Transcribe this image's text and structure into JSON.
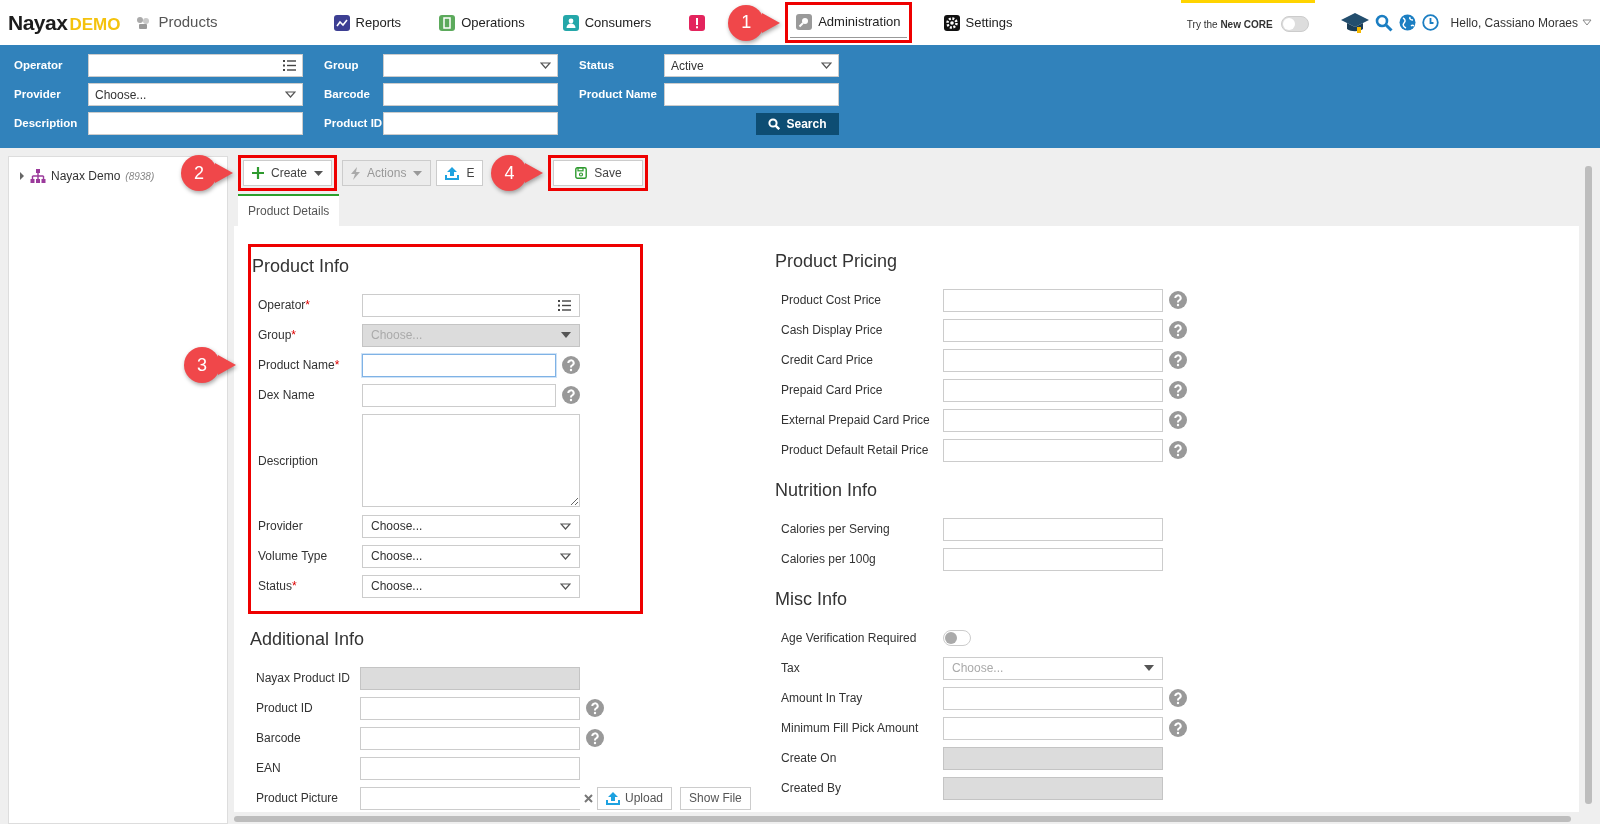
{
  "header": {
    "logo": "Nayax",
    "logo_tag": "DEMO",
    "page_title": "Products",
    "nav": [
      {
        "kind": "reports",
        "label": "Reports",
        "selected": false,
        "highlighted": false
      },
      {
        "kind": "operations",
        "label": "Operations",
        "selected": false,
        "highlighted": false
      },
      {
        "kind": "consumers",
        "label": "Consumers",
        "selected": false,
        "highlighted": false
      },
      {
        "kind": "alerts",
        "selected": false,
        "highlighted": false
      },
      {
        "kind": "administration",
        "label": "Administration",
        "selected": true,
        "highlighted": true,
        "callout": "1"
      },
      {
        "kind": "settings",
        "label": "Settings",
        "selected": false,
        "highlighted": false
      }
    ],
    "promo": {
      "text": "Try the **New CORE**",
      "on": false
    },
    "greeting": "Hello, Cassiano Moraes"
  },
  "filters": {
    "fields": [
      {
        "label": "Operator",
        "kind": "list"
      },
      {
        "label": "Group",
        "kind": "select"
      },
      {
        "label": "Status",
        "kind": "select",
        "value": "Active"
      },
      {
        "label": "Provider",
        "kind": "select",
        "value": "Choose..."
      },
      {
        "label": "Barcode",
        "kind": "text"
      },
      {
        "label": "Product Name",
        "kind": "text"
      },
      {
        "label": "Description",
        "kind": "text"
      },
      {
        "label": "Product ID",
        "kind": "text"
      }
    ],
    "search_label": "Search"
  },
  "tree": [
    {
      "label": "Nayax Demo",
      "count": "(8938)",
      "expanded": false
    }
  ],
  "toolbar": [
    {
      "kind": "create",
      "label": "Create",
      "disabled": false,
      "dropdown": true,
      "highlighted": true,
      "callout": "2"
    },
    {
      "kind": "actions",
      "label": "Actions",
      "disabled": true,
      "dropdown": true,
      "highlighted": false
    },
    {
      "kind": "export",
      "label": "E",
      "disabled": false,
      "dropdown": false,
      "highlighted": false
    },
    {
      "kind": "save",
      "label": "Save",
      "disabled": false,
      "dropdown": false,
      "highlighted": true,
      "callout": "4"
    }
  ],
  "tabs": [
    {
      "label": "Product Details",
      "selected": true
    }
  ],
  "form": {
    "columns": [
      {
        "sections": [
          {
            "title": "Product Info",
            "highlighted": true,
            "fields": [
              {
                "label": "Operator",
                "mark": "*",
                "kind": "list",
                "help": false,
                "disabled": false,
                "focused": false
              },
              {
                "label": "Group",
                "mark": "*",
                "kind": "combo",
                "placeholder": "Choose...",
                "help": false,
                "disabled": true,
                "focused": false
              },
              {
                "label": "Product Name",
                "mark": "*",
                "kind": "text",
                "help": true,
                "disabled": false,
                "focused": true,
                "callout": "3"
              },
              {
                "label": "Dex Name",
                "kind": "text",
                "help": true,
                "disabled": false,
                "focused": false
              },
              {
                "label": "Description",
                "kind": "textarea",
                "help": false,
                "disabled": false,
                "focused": false
              },
              {
                "label": "Provider",
                "kind": "select",
                "value": "Choose...",
                "help": false,
                "disabled": false,
                "focused": false
              },
              {
                "label": "Volume Type",
                "kind": "select",
                "value": "Choose...",
                "help": false,
                "disabled": false,
                "focused": false
              },
              {
                "label": "Status",
                "mark": "*",
                "kind": "select",
                "value": "Choose...",
                "help": false,
                "disabled": false,
                "focused": false
              }
            ]
          },
          {
            "title": "Additional Info",
            "highlighted": false,
            "fields": [
              {
                "label": "Nayax Product ID",
                "kind": "text",
                "help": false,
                "disabled": true,
                "focused": false
              },
              {
                "label": "Product ID",
                "kind": "text",
                "help": true,
                "disabled": false,
                "focused": false
              },
              {
                "label": "Barcode",
                "kind": "text",
                "help": true,
                "disabled": false,
                "focused": false
              },
              {
                "label": "EAN",
                "kind": "text",
                "help": false,
                "disabled": false,
                "focused": false
              },
              {
                "label": "Product Picture",
                "kind": "picture",
                "upload_label": "Upload",
                "show_label": "Show File",
                "help": false
              }
            ]
          }
        ]
      },
      {
        "sections": [
          {
            "title": "Product Pricing",
            "highlighted": false,
            "fields": [
              {
                "label": "Product Cost Price",
                "kind": "text",
                "help": true,
                "disabled": false,
                "focused": false
              },
              {
                "label": "Cash Display Price",
                "kind": "text",
                "help": true,
                "disabled": false,
                "focused": false
              },
              {
                "label": "Credit Card Price",
                "kind": "text",
                "help": true,
                "disabled": false,
                "focused": false
              },
              {
                "label": "Prepaid Card Price",
                "kind": "text",
                "help": true,
                "disabled": false,
                "focused": false
              },
              {
                "label": "External Prepaid Card Price",
                "kind": "text",
                "help": true,
                "disabled": false,
                "focused": false
              },
              {
                "label": "Product Default Retail Price",
                "kind": "text",
                "help": true,
                "disabled": false,
                "focused": false
              }
            ]
          },
          {
            "title": "Nutrition Info",
            "highlighted": false,
            "fields": [
              {
                "label": "Calories per Serving",
                "kind": "text",
                "help": false,
                "disabled": false,
                "focused": false
              },
              {
                "label": "Calories per 100g",
                "kind": "text",
                "help": false,
                "disabled": false,
                "focused": false
              }
            ]
          },
          {
            "title": "Misc Info",
            "highlighted": false,
            "fields": [
              {
                "label": "Age Verification Required",
                "kind": "toggle",
                "on": false,
                "help": false
              },
              {
                "label": "Tax",
                "kind": "combo",
                "placeholder": "Choose...",
                "help": false,
                "disabled": false,
                "focused": false
              },
              {
                "label": "Amount In Tray",
                "kind": "text",
                "help": true,
                "disabled": false,
                "focused": false
              },
              {
                "label": "Minimum Fill Pick Amount",
                "kind": "text",
                "help": true,
                "disabled": false,
                "focused": false
              },
              {
                "label": "Create On",
                "kind": "text",
                "help": false,
                "disabled": true,
                "focused": false
              },
              {
                "label": "Created By",
                "kind": "text",
                "help": false,
                "disabled": true,
                "focused": false
              }
            ]
          }
        ]
      }
    ]
  }
}
